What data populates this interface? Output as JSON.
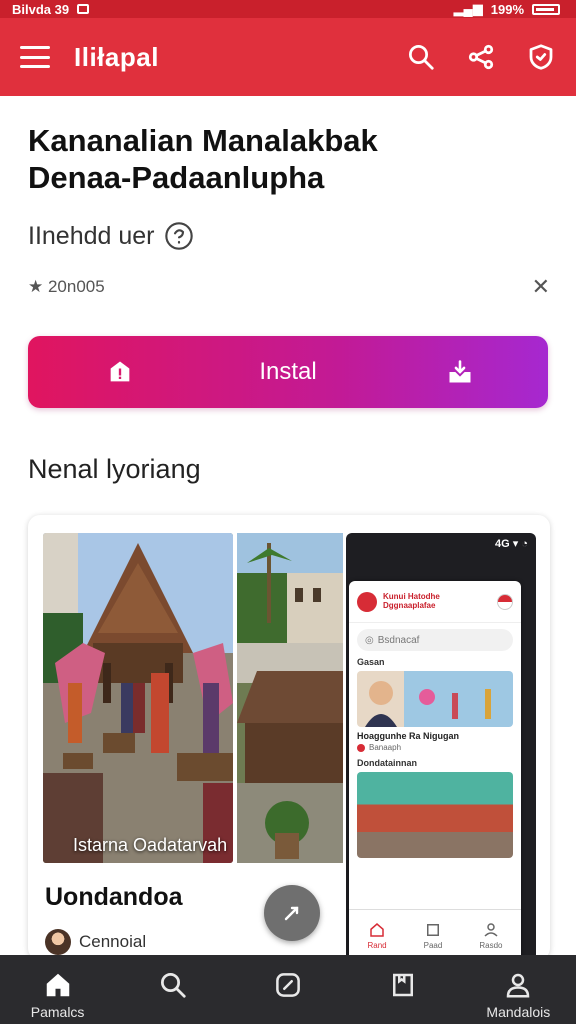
{
  "status_bar": {
    "left_text": "Bilvda 39",
    "right_text": "199%"
  },
  "app_bar": {
    "title": "Iliłapal",
    "icons": [
      "menu-icon",
      "search-icon",
      "share-icon",
      "shield-icon"
    ]
  },
  "heading": {
    "line1": "Kananalian Manalakbak",
    "line2": "Denaa-Padaanlupha"
  },
  "subtitle": "IInehdd uer",
  "meta": {
    "rating_text": "★ 20n005"
  },
  "install_button": {
    "label": "Instal"
  },
  "section_title": "Nenal lyoriang",
  "card": {
    "photo_caption": "Istarna Oadatarvah",
    "title": "Uondandoa",
    "author": "Cennoial"
  },
  "phone_preview": {
    "status": "4G",
    "header_title": "Kunui Hatodhe Dggnaaplafae",
    "search_placeholder": "Bsdnacaf",
    "section1": "Gasan",
    "item1_caption": "Hoaggunhe Ra Nigugan",
    "item1_meta": "Banaaph",
    "section2": "Dondatainnan",
    "nav": [
      "Rand",
      "Paad",
      "Rasdo"
    ]
  },
  "bottom_nav": {
    "items": [
      {
        "label": "Pamalcs",
        "icon": "home-icon"
      },
      {
        "label": "",
        "icon": "search-icon"
      },
      {
        "label": "",
        "icon": "compass-icon"
      },
      {
        "label": "",
        "icon": "bookmark-icon"
      },
      {
        "label": "Mandalois",
        "icon": "profile-icon"
      }
    ]
  },
  "colors": {
    "app_bar": "#e0303d",
    "install_gradient_start": "#e0155f",
    "install_gradient_end": "#a628d0",
    "bottom_nav": "#2b2b2e"
  }
}
